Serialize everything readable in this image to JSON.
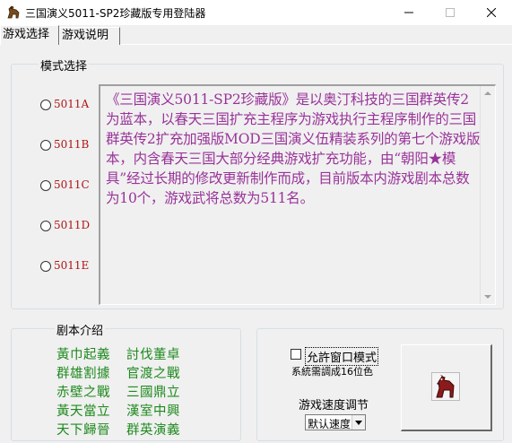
{
  "window": {
    "title": "三国演义5011-SP2珍藏版专用登陆器",
    "icons": {
      "app": "horse-icon",
      "minimize": "minimize-icon",
      "maximize": "maximize-icon",
      "close": "close-icon"
    }
  },
  "tabs": [
    {
      "label": "游戏选择",
      "active": true
    },
    {
      "label": "游戏说明",
      "active": false
    }
  ],
  "mode_select": {
    "title": "模式选择",
    "options": [
      "5011A",
      "5011B",
      "5011C",
      "5011D",
      "5011E"
    ],
    "selected": null,
    "description": "《三国演义5011-SP2珍藏版》是以奥汀科技的三国群英传2为蓝本，以春天三国扩充主程序为游戏执行主程序制作的三国群英传2扩充加强版MOD三国演义伍精装系列的第七个游戏版本，内含春天三国大部分经典游戏扩充功能，由“朝阳★模具”经过长期的修改更新制作而成，目前版本内游戏剧本总数为10个，游戏武将总数为511名。",
    "description_color": "#993399"
  },
  "scripts": {
    "title": "剧本介绍",
    "items": [
      "黃巾起義",
      "討伐董卓",
      "群雄割據",
      "官渡之戰",
      "赤壁之戰",
      "三國鼎立",
      "黃天當立",
      "漢室中興",
      "天下歸晉",
      "群英演義"
    ],
    "item_color": "#1e8a1e"
  },
  "options": {
    "window_mode_label": "允許窗口模式",
    "window_mode_checked": false,
    "color_note": "系統需調成16位色",
    "speed_label": "游戏速度调节",
    "speed_value": "默认速度",
    "launch_icon": "horse-icon"
  }
}
